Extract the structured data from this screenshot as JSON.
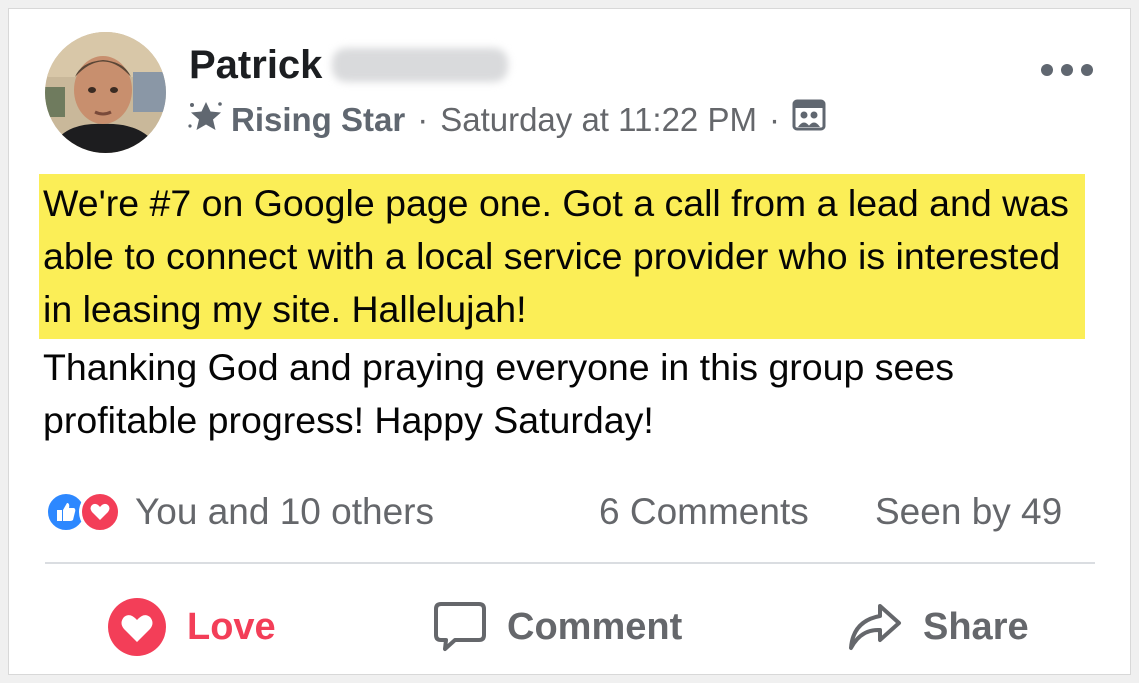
{
  "post": {
    "author_first_name": "Patrick",
    "badge_label": "Rising Star",
    "timestamp": "Saturday at 11:22 PM",
    "separator": "·",
    "highlighted_text": "We're #7 on Google page one. Got a call from a lead and was able to connect with a local service provider who is interested in leasing my site. Hallelujah!",
    "body_text": "Thanking God and praying everyone in this group sees profitable progress! Happy Saturday!"
  },
  "engagement": {
    "reactions_text": "You and 10 others",
    "comments_text": "6 Comments",
    "seen_text": "Seen by 49"
  },
  "actions": {
    "love_label": "Love",
    "comment_label": "Comment",
    "share_label": "Share"
  },
  "colors": {
    "highlight": "#fbee57",
    "love": "#f33e58",
    "like": "#2d88ff",
    "secondary_text": "#65676b"
  },
  "icons": [
    "star-badge-icon",
    "group-audience-icon",
    "more-options-icon",
    "like-reaction-icon",
    "love-reaction-icon",
    "heart-icon",
    "comment-bubble-icon",
    "share-arrow-icon"
  ]
}
